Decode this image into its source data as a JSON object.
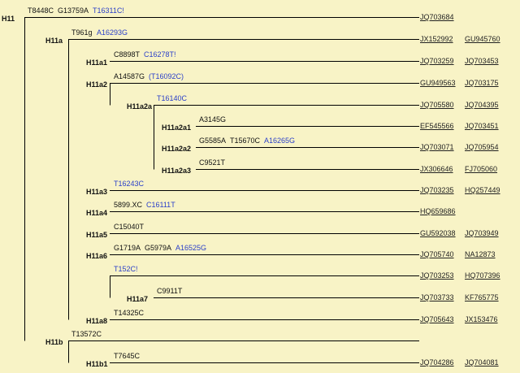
{
  "rows": [
    {
      "id": "r-h11",
      "label": "H11",
      "mutations": [
        {
          "text": "T8448C",
          "blue": false
        },
        {
          "text": "G13759A",
          "blue": false
        },
        {
          "text": "T16311C!",
          "blue": true
        }
      ],
      "accessions": [
        "JQ703684"
      ]
    },
    {
      "id": "r-h11a",
      "label": "H11a",
      "mutations": [
        {
          "text": "T961g",
          "blue": false
        },
        {
          "text": "A16293G",
          "blue": true
        }
      ],
      "accessions": [
        "JX152992",
        "GU945760"
      ]
    },
    {
      "id": "r-h11a1",
      "label": "H11a1",
      "mutations": [
        {
          "text": "C8898T",
          "blue": false
        },
        {
          "text": "C16278T!",
          "blue": true
        }
      ],
      "accessions": [
        "JQ703259",
        "JQ703453"
      ]
    },
    {
      "id": "r-h11a2",
      "label": "H11a2",
      "mutations": [
        {
          "text": "A14587G",
          "blue": false
        },
        {
          "text": "(T16092C)",
          "blue": true
        }
      ],
      "accessions": [
        "GU949563",
        "JQ703175"
      ]
    },
    {
      "id": "r-h11a2a",
      "label": "H11a2a",
      "mutations": [
        {
          "text": "T16140C",
          "blue": true
        }
      ],
      "accessions": [
        "JQ705580",
        "JQ704395"
      ]
    },
    {
      "id": "r-h11a2a1",
      "label": "H11a2a1",
      "mutations": [
        {
          "text": "A3145G",
          "blue": false
        }
      ],
      "accessions": [
        "EF545566",
        "JQ703451"
      ]
    },
    {
      "id": "r-h11a2a2",
      "label": "H11a2a2",
      "mutations": [
        {
          "text": "G5585A",
          "blue": false
        },
        {
          "text": "T15670C",
          "blue": false
        },
        {
          "text": "A16265G",
          "blue": true
        }
      ],
      "accessions": [
        "JQ703071",
        "JQ705954"
      ]
    },
    {
      "id": "r-h11a2a3",
      "label": "H11a2a3",
      "mutations": [
        {
          "text": "C9521T",
          "blue": false
        }
      ],
      "accessions": [
        "JX306646",
        "FJ705060"
      ]
    },
    {
      "id": "r-h11a3",
      "label": "H11a3",
      "mutations": [
        {
          "text": "T16243C",
          "blue": true
        }
      ],
      "accessions": [
        "JQ703235",
        "HQ257449"
      ]
    },
    {
      "id": "r-h11a4",
      "label": "H11a4",
      "mutations": [
        {
          "text": "5899.XC",
          "blue": false
        },
        {
          "text": "C16111T",
          "blue": true
        }
      ],
      "accessions": [
        "HQ659686"
      ]
    },
    {
      "id": "r-h11a5",
      "label": "H11a5",
      "mutations": [
        {
          "text": "C15040T",
          "blue": false
        }
      ],
      "accessions": [
        "GU592038",
        "JQ703949"
      ]
    },
    {
      "id": "r-h11a6",
      "label": "H11a6",
      "mutations": [
        {
          "text": "G1719A",
          "blue": false
        },
        {
          "text": "G5979A",
          "blue": false
        },
        {
          "text": "A16525G",
          "blue": true
        }
      ],
      "accessions": [
        "JQ705740",
        "NA12873"
      ]
    },
    {
      "id": "r-t152",
      "label": "",
      "mutations": [
        {
          "text": "T152C!",
          "blue": true
        }
      ],
      "accessions": [
        "JQ703253",
        "HQ707396"
      ]
    },
    {
      "id": "r-h11a7",
      "label": "H11a7",
      "mutations": [
        {
          "text": "C9911T",
          "blue": false
        }
      ],
      "accessions": [
        "JQ703733",
        "KF765775"
      ]
    },
    {
      "id": "r-h11a8",
      "label": "H11a8",
      "mutations": [
        {
          "text": "T14325C",
          "blue": false
        }
      ],
      "accessions": [
        "JQ705643",
        "JX153476"
      ]
    },
    {
      "id": "r-h11b",
      "label": "H11b",
      "mutations": [
        {
          "text": "T13572C",
          "blue": false
        }
      ],
      "accessions": []
    },
    {
      "id": "r-h11b1",
      "label": "H11b1",
      "mutations": [
        {
          "text": "T7645C",
          "blue": false
        }
      ],
      "accessions": [
        "JQ704286",
        "JQ704081"
      ]
    }
  ],
  "colors": {
    "background": "#f8f3c6",
    "line": "#000000",
    "mutation_blue": "#2a3fc9"
  }
}
